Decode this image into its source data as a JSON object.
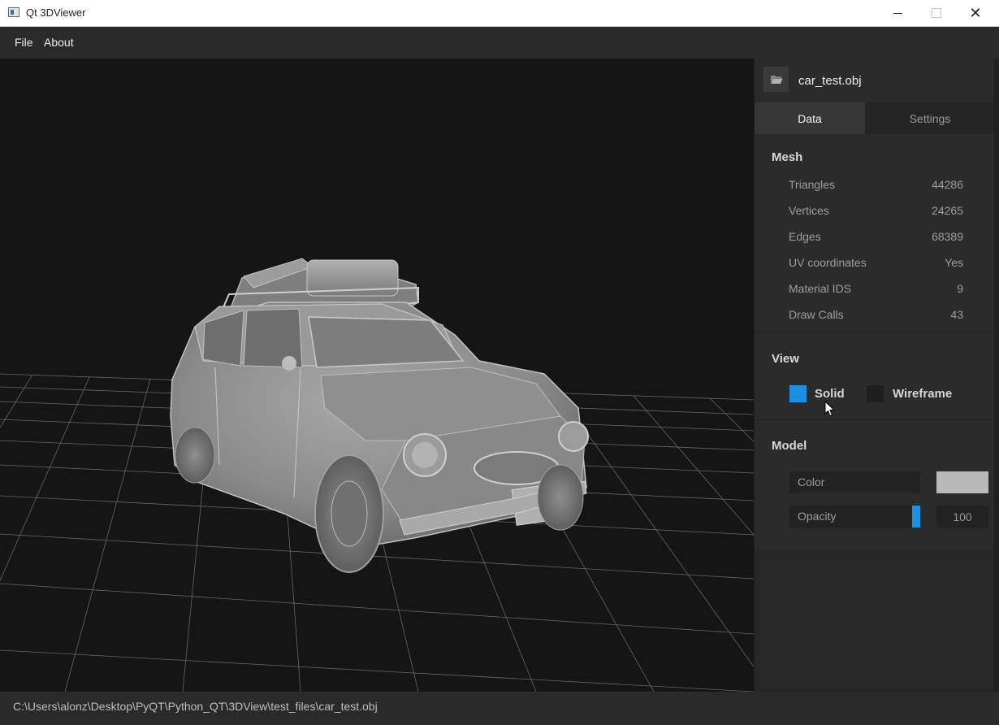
{
  "window": {
    "title": "Qt 3DViewer",
    "close_glyph": "✕"
  },
  "menu": {
    "file": "File",
    "about": "About"
  },
  "file": {
    "name": "car_test.obj"
  },
  "tabs": {
    "data": "Data",
    "settings": "Settings"
  },
  "mesh": {
    "title": "Mesh",
    "rows": [
      {
        "label": "Triangles",
        "value": "44286"
      },
      {
        "label": "Vertices",
        "value": "24265"
      },
      {
        "label": "Edges",
        "value": "68389"
      },
      {
        "label": "UV coordinates",
        "value": "Yes"
      },
      {
        "label": "Material IDS",
        "value": "9"
      },
      {
        "label": "Draw Calls",
        "value": "43"
      }
    ]
  },
  "view": {
    "title": "View",
    "solid": "Solid",
    "wireframe": "Wireframe",
    "solid_checked": true,
    "wireframe_checked": false
  },
  "model": {
    "title": "Model",
    "color_label": "Color",
    "color_value": "#b9b9b9",
    "opacity_label": "Opacity",
    "opacity_value": "100"
  },
  "status": {
    "path": "C:\\Users\\alonz\\Desktop\\PyQT\\Python_QT\\3DView\\test_files\\car_test.obj"
  },
  "colors": {
    "accent": "#1e8fe0",
    "panel": "#2b2b2b",
    "viewport_bg": "#151515"
  },
  "icons": {
    "folder": "folder-open-icon",
    "app": "qt-app-icon"
  }
}
